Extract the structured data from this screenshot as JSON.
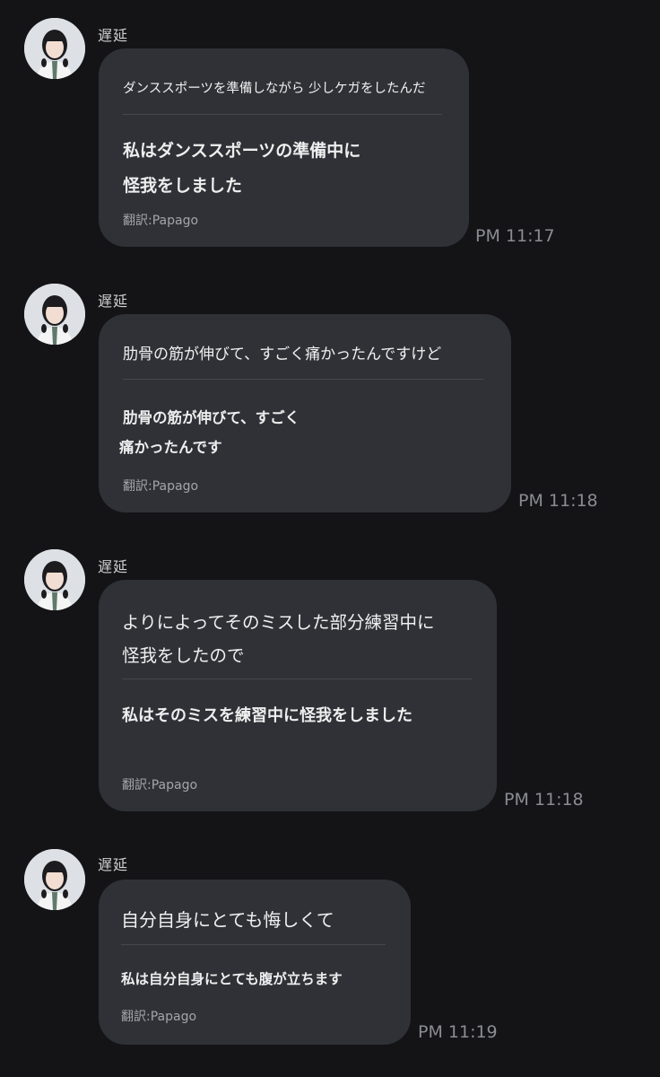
{
  "colors": {
    "background": "#141417",
    "bubble": "#2f3137",
    "divider": "#45474e",
    "timestamp": "#8a8c91"
  },
  "avatar_icon": "profile-photo",
  "messages": [
    {
      "sender": "遅延",
      "original": [
        "ダンススポーツを準備しながら 少しケガをしたんだ"
      ],
      "translation": [
        "私はダンススポーツの準備中に",
        "怪我をしました"
      ],
      "credit": "翻訳:Papago",
      "time": "PM 11:17"
    },
    {
      "sender": "遅延",
      "original": [
        "肋骨の筋が伸びて、すごく痛かったんですけど"
      ],
      "translation": [
        "肋骨の筋が伸びて、すごく",
        "痛かったんです"
      ],
      "credit": "翻訳:Papago",
      "time": "PM 11:18"
    },
    {
      "sender": "遅延",
      "original": [
        "よりによってそのミスした部分練習中に",
        "怪我をしたので"
      ],
      "translation": [
        "私はそのミスを練習中に怪我をしました"
      ],
      "credit": "翻訳:Papago",
      "time": "PM 11:18"
    },
    {
      "sender": "遅延",
      "original": [
        "自分自身にとても悔しくて"
      ],
      "translation": [
        "私は自分自身にとても腹が立ちます"
      ],
      "credit": "翻訳:Papago",
      "time": "PM 11:19"
    }
  ]
}
